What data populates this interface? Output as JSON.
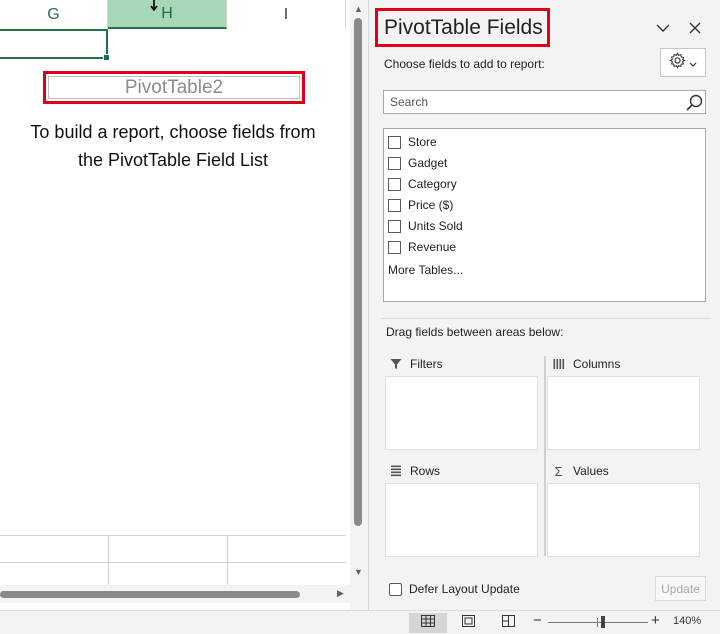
{
  "sheet": {
    "columns": [
      "G",
      "H",
      "I"
    ],
    "selected_column": "H",
    "pivot_name": "PivotTable2",
    "instruction_line1": "To build a report, choose fields from",
    "instruction_line2": "the PivotTable Field List"
  },
  "pane": {
    "title": "PivotTable Fields",
    "choose_label": "Choose fields to add to report:",
    "search_placeholder": "Search",
    "fields": [
      {
        "label": "Store",
        "checked": false
      },
      {
        "label": "Gadget",
        "checked": false
      },
      {
        "label": "Category",
        "checked": false
      },
      {
        "label": "Price ($)",
        "checked": false
      },
      {
        "label": "Units Sold",
        "checked": false
      },
      {
        "label": "Revenue",
        "checked": false
      }
    ],
    "more_tables": "More Tables...",
    "drag_label": "Drag fields between areas below:",
    "areas": {
      "filters": "Filters",
      "columns": "Columns",
      "rows": "Rows",
      "values": "Values"
    },
    "defer_label": "Defer Layout Update",
    "update_label": "Update"
  },
  "statusbar": {
    "zoom_minus": "−",
    "zoom_plus": "+",
    "zoom_level": "140%",
    "active_view": "normal"
  },
  "colors": {
    "highlight_red": "#e0001a",
    "excel_green": "#217346",
    "selected_header": "#a7d7b9"
  }
}
